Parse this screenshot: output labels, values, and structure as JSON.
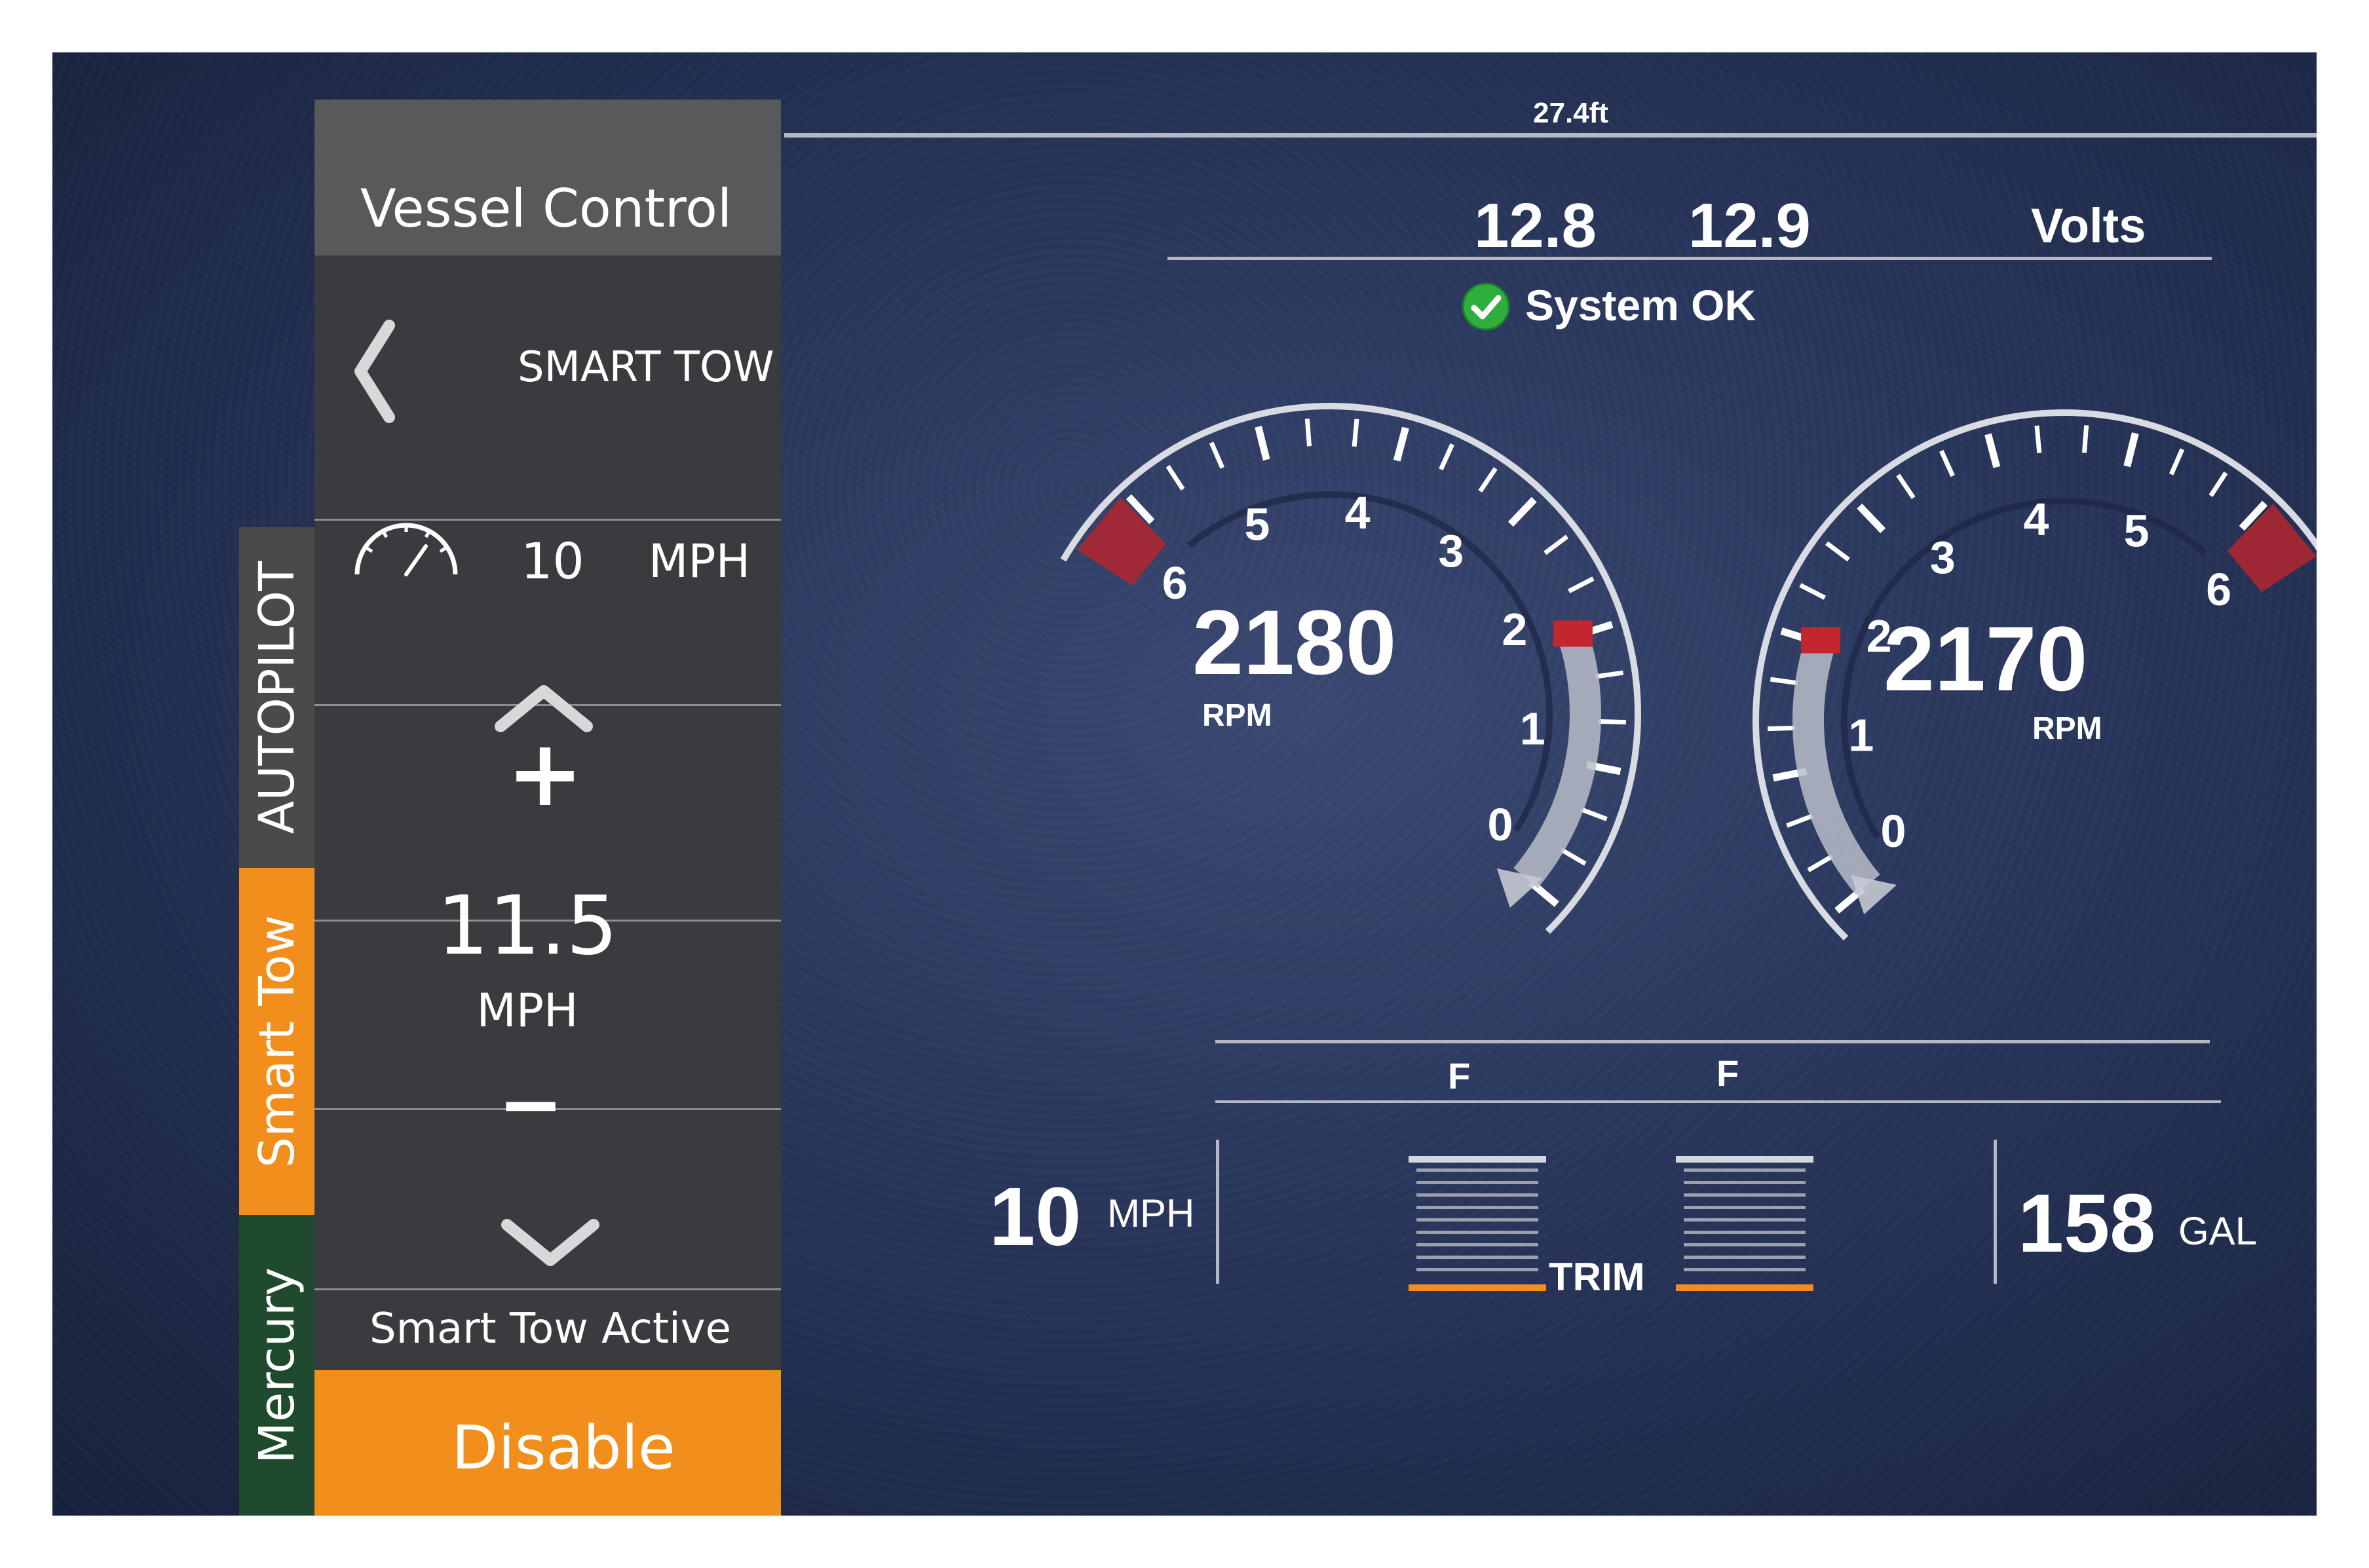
{
  "depth": "27.4ft",
  "volts": {
    "left": "12.8",
    "right": "12.9",
    "label": "Volts"
  },
  "system_status": "System OK",
  "panel": {
    "title": "Vessel Control",
    "mode": "SMART TOW",
    "speed_value": "10",
    "speed_unit": "MPH",
    "plus_label": "+",
    "set_value": "11.5",
    "set_unit": "MPH",
    "minus_label": "−",
    "status": "Smart Tow Active",
    "disable_label": "Disable"
  },
  "side_tabs": {
    "autopilot": "AUTOPILOT",
    "smart_tow": "Smart Tow",
    "mercury": "Mercury"
  },
  "engines": {
    "left": {
      "rpm_value": "2180",
      "rpm_label": "RPM",
      "ticks": [
        "0",
        "1",
        "2",
        "3",
        "4",
        "5",
        "6"
      ]
    },
    "right": {
      "rpm_value": "2170",
      "rpm_label": "RPM",
      "ticks": [
        "0",
        "1",
        "2",
        "3",
        "4",
        "5",
        "6"
      ]
    }
  },
  "trim": {
    "left_label": "F",
    "right_label": "F",
    "label": "TRIM"
  },
  "speed": {
    "value": "10",
    "unit": "MPH"
  },
  "fuel": {
    "value": "158",
    "unit": "GAL"
  },
  "colors": {
    "orange": "#f28f1c",
    "panel": "#3a3b3f",
    "green_tab": "#1f4a2e",
    "redline": "#b3262e"
  }
}
